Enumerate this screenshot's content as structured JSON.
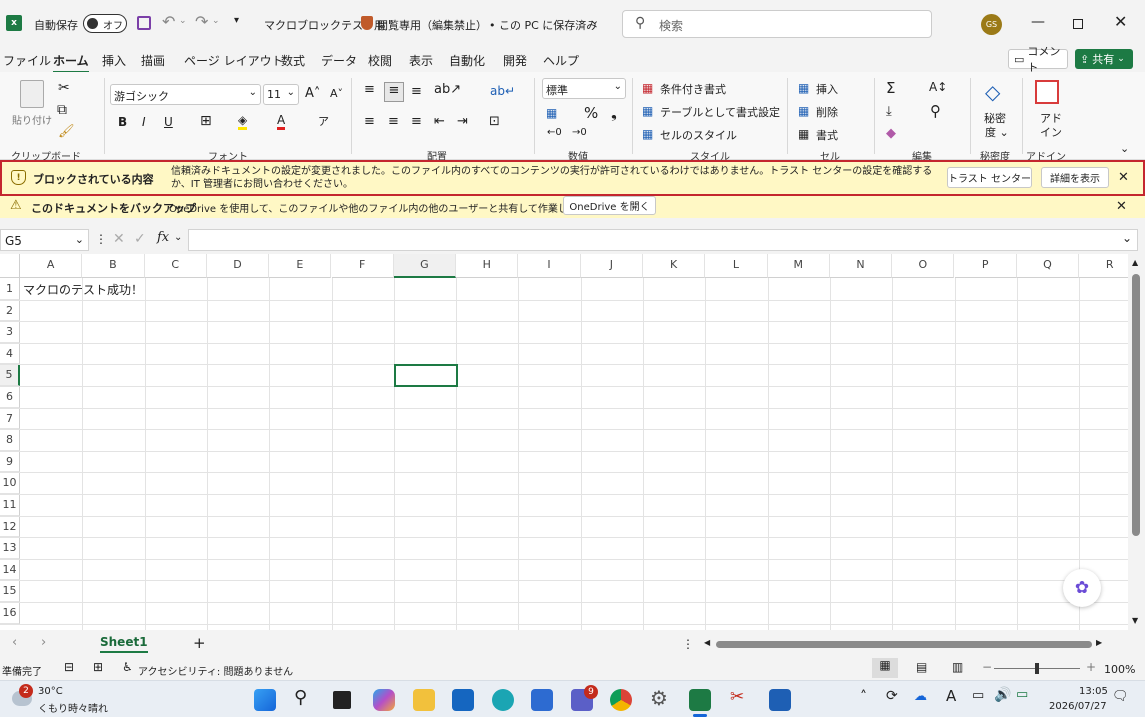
{
  "title_bar": {
    "autosave_label": "自動保存",
    "autosave_toggle": "オフ",
    "document_title": "マクロブロックテスト用",
    "readonly_label": "閲覧専用（編集禁止）",
    "save_location": "• この PC に保存済み",
    "search_placeholder": "検索",
    "user_initials": "GS"
  },
  "menu": {
    "tabs": [
      "ファイル",
      "ホーム",
      "挿入",
      "描画",
      "ページ レイアウト",
      "数式",
      "データ",
      "校閲",
      "表示",
      "自動化",
      "開発",
      "ヘルプ"
    ],
    "active_tab": "ホーム",
    "comment_button": "コメント",
    "share_button": "共有"
  },
  "ribbon": {
    "paste_label": "貼り付け",
    "font_name": "游ゴシック",
    "font_size": "11",
    "number_format": "標準",
    "conditional_format": "条件付き書式",
    "format_as_table": "テーブルとして書式設定",
    "cell_styles": "セルのスタイル",
    "insert": "挿入",
    "delete": "削除",
    "format": "書式",
    "sensitivity": "秘密度",
    "addin": "アドイン",
    "groups": [
      "クリップボード",
      "フォント",
      "配置",
      "数値",
      "スタイル",
      "セル",
      "編集",
      "秘密度",
      "アドイン"
    ],
    "bold": "B",
    "italic": "I",
    "underline": "U"
  },
  "warning_bar": {
    "title": "ブロックされている内容",
    "message": "信頼済みドキュメントの設定が変更されました。このファイル内のすべてのコンテンツの実行が許可されているわけではありません。トラスト センターの設定を確認するか、IT 管理者にお問い合わせください。",
    "trust_center_button": "トラスト センター",
    "details_button": "詳細を表示"
  },
  "backup_bar": {
    "title": "このドキュメントをバックアップ",
    "message": "OneDrive を使用して、このファイルや他のファイル内の他のユーザーと共有して作業します。",
    "button": "OneDrive を開く"
  },
  "formula_bar": {
    "name_box": "G5",
    "fx": "fx",
    "formula": ""
  },
  "sheet": {
    "columns": [
      "A",
      "B",
      "C",
      "D",
      "E",
      "F",
      "G",
      "H",
      "I",
      "J",
      "K",
      "L",
      "M",
      "N",
      "O",
      "P",
      "Q",
      "R"
    ],
    "rows": [
      "1",
      "2",
      "3",
      "4",
      "5",
      "6",
      "7",
      "8",
      "9",
      "10",
      "11",
      "12",
      "13",
      "14",
      "15",
      "16"
    ],
    "cell_a1": "マクロのテスト成功！",
    "selected_cell": "G5"
  },
  "sheet_tabs": {
    "active_sheet": "Sheet1",
    "add": "+"
  },
  "status_bar": {
    "ready": "準備完了",
    "accessibility": "アクセシビリティ: 問題ありません",
    "zoom": "100%",
    "zoom_minus": "−",
    "zoom_plus": "+"
  },
  "taskbar": {
    "weather_temp": "30°C",
    "weather_desc": "くもり時々晴れ",
    "weather_badge": "2",
    "teams_badge": "9",
    "time": "13:05",
    "date": "2026/07/27"
  }
}
